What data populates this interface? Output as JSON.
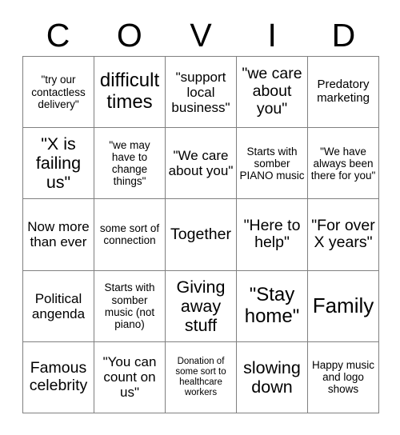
{
  "header": {
    "letters": [
      "C",
      "O",
      "V",
      "I",
      "D"
    ]
  },
  "grid": {
    "columns": 5,
    "rows": 5,
    "cells": [
      {
        "text": "\"try our contactless delivery\"",
        "size": "fs-13"
      },
      {
        "text": "difficult times",
        "size": "fs-24"
      },
      {
        "text": "\"support local business\"",
        "size": "fs-17"
      },
      {
        "text": "\"we care about you\"",
        "size": "fs-19"
      },
      {
        "text": "Predatory marketing",
        "size": "fs-15"
      },
      {
        "text": "\"X is failing us\"",
        "size": "fs-21"
      },
      {
        "text": "\"we may have to change things\"",
        "size": "fs-13"
      },
      {
        "text": "\"We care about you\"",
        "size": "fs-17"
      },
      {
        "text": "Starts with somber PIANO music",
        "size": "fs-13"
      },
      {
        "text": "\"We have always been there for you\"",
        "size": "fs-13"
      },
      {
        "text": "Now more than ever",
        "size": "fs-17"
      },
      {
        "text": "some sort of connection",
        "size": "fs-13"
      },
      {
        "text": "Together",
        "size": "fs-19"
      },
      {
        "text": "\"Here to help\"",
        "size": "fs-19"
      },
      {
        "text": "\"For over X years\"",
        "size": "fs-19"
      },
      {
        "text": "Political angenda",
        "size": "fs-17"
      },
      {
        "text": "Starts with somber music (not piano)",
        "size": "fs-13"
      },
      {
        "text": "Giving away stuff",
        "size": "fs-21"
      },
      {
        "text": "\"Stay home\"",
        "size": "fs-24"
      },
      {
        "text": "Family",
        "size": "fs-26"
      },
      {
        "text": "Famous celebrity",
        "size": "fs-19"
      },
      {
        "text": "\"You can count on us\"",
        "size": "fs-17"
      },
      {
        "text": "Donation of some sort to healthcare workers",
        "size": "fs-11"
      },
      {
        "text": "slowing down",
        "size": "fs-21"
      },
      {
        "text": "Happy music and logo shows",
        "size": "fs-13"
      }
    ]
  },
  "colors": {
    "background": "#ffffff",
    "text": "#000000",
    "grid_line": "#808080"
  }
}
